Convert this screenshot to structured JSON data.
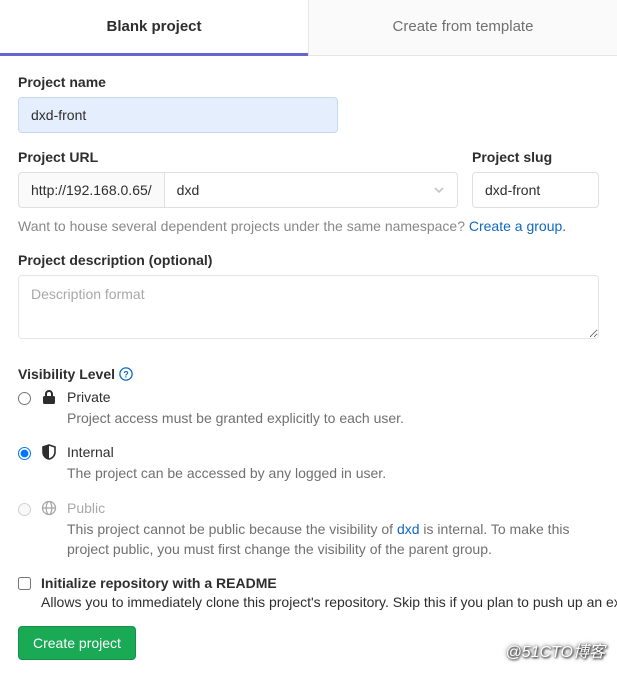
{
  "tabs": {
    "blank": "Blank project",
    "template": "Create from template"
  },
  "project_name": {
    "label": "Project name",
    "value": "dxd-front"
  },
  "project_url": {
    "label": "Project URL",
    "prefix": "http://192.168.0.65/",
    "namespace": "dxd"
  },
  "project_slug": {
    "label": "Project slug",
    "value": "dxd-front"
  },
  "namespace_hint": {
    "text": "Want to house several dependent projects under the same namespace? ",
    "link": "Create a group."
  },
  "description": {
    "label": "Project description (optional)",
    "placeholder": "Description format"
  },
  "visibility": {
    "label": "Visibility Level",
    "options": {
      "private": {
        "title": "Private",
        "desc": "Project access must be granted explicitly to each user."
      },
      "internal": {
        "title": "Internal",
        "desc": "The project can be accessed by any logged in user."
      },
      "public": {
        "title": "Public",
        "desc_before": "This project cannot be public because the visibility of ",
        "desc_link": "dxd",
        "desc_after": " is internal. To make this project public, you must first change the visibility of the parent group."
      }
    }
  },
  "readme": {
    "title": "Initialize repository with a README",
    "desc": "Allows you to immediately clone this project's repository. Skip this if you plan to push up an existing repository."
  },
  "submit": {
    "create": "Create project"
  },
  "watermark": "@51CTO博客"
}
